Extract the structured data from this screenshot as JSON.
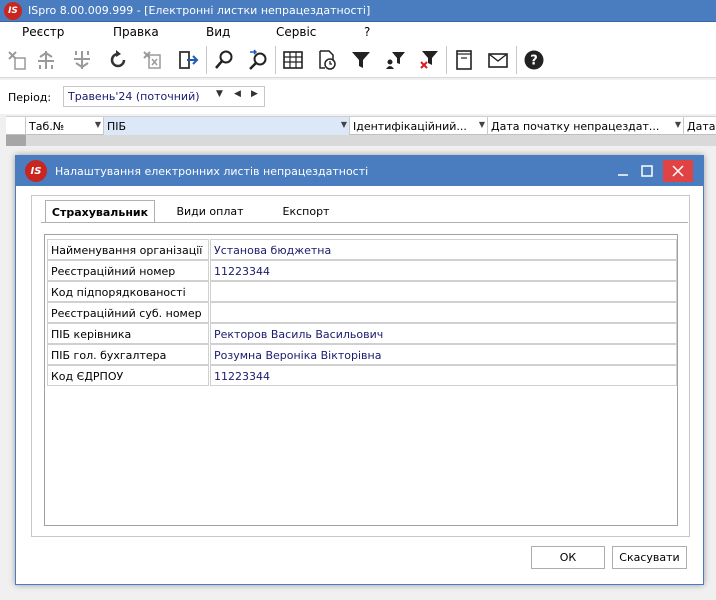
{
  "app": {
    "title": "ISpro 8.00.009.999 - [Електронні листки непрацездатності]",
    "logo": "IS"
  },
  "menu": [
    "Реєстр",
    "Правка",
    "Вид",
    "Сервіс",
    "?"
  ],
  "toolbar_icons": [
    "add-icon",
    "split-icon",
    "merge-icon",
    "refresh-icon",
    "delete-icon",
    "exit-icon",
    "search-icon",
    "find-next-icon",
    "table-icon",
    "calendar-clock-icon",
    "filter-icon",
    "user-filter-icon",
    "clear-filter-icon",
    "notebook-icon",
    "mail-icon",
    "help-icon"
  ],
  "period": {
    "label": "Період:",
    "value": "Травень'24 (поточний)"
  },
  "grid": {
    "columns": [
      "Таб.№",
      "ПІБ",
      "Ідентифікаційний...",
      "Дата початку непрацездат...",
      "Дата"
    ]
  },
  "dialog": {
    "title": "Налаштування електронних листів непрацездатності",
    "tabs": [
      "Страхувальник",
      "Види оплат",
      "Експорт"
    ],
    "rows": [
      {
        "label": "Найменування організації",
        "value": "Установа бюджетна"
      },
      {
        "label": "Реєстраційний номер",
        "value": "11223344"
      },
      {
        "label": "Код підпорядкованості",
        "value": ""
      },
      {
        "label": "Реєстраційний суб. номер",
        "value": ""
      },
      {
        "label": "ПІБ керівника",
        "value": "Ректоров Василь Васильович"
      },
      {
        "label": "ПІБ  гол. бухгалтера",
        "value": "Розумна Вероніка Вікторівна"
      },
      {
        "label": "Код ЄДРПОУ",
        "value": "11223344"
      }
    ],
    "ok_label": "ОК",
    "cancel_label": "Скасувати"
  }
}
